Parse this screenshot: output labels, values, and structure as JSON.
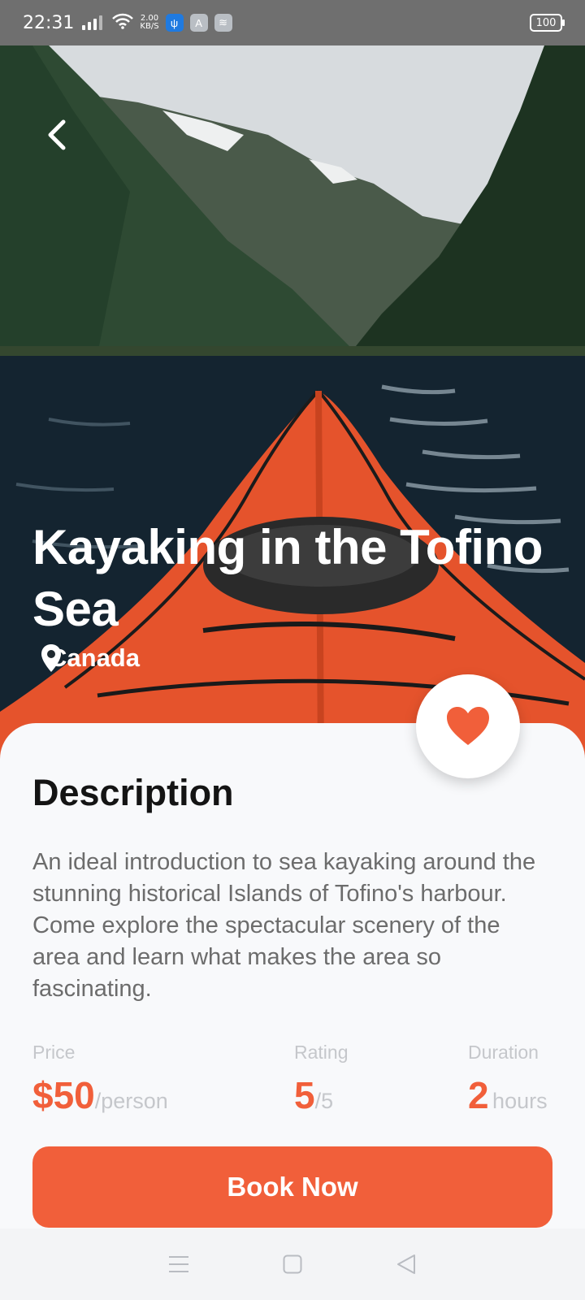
{
  "status_bar": {
    "time": "22:31",
    "net_speed_value": "2.00",
    "net_speed_unit": "KB/S",
    "battery": "100"
  },
  "hero": {
    "title": "Kayaking in the Tofino Sea",
    "location": "Canada"
  },
  "description": {
    "heading": "Description",
    "text": "An ideal introduction to sea kayaking around the stunning historical Islands of Tofino's harbour. Come explore the spectacular scenery of the area and learn what makes the area so fascinating."
  },
  "stats": {
    "price": {
      "label": "Price",
      "value": "$50",
      "unit": "/person"
    },
    "rating": {
      "label": "Rating",
      "value": "5",
      "unit": "/5"
    },
    "duration": {
      "label": "Duration",
      "value": "2",
      "unit": "hours"
    }
  },
  "book_button": {
    "label": "Book Now"
  },
  "colors": {
    "accent": "#f15f3a",
    "background": "#f8f9fb"
  },
  "icons": {
    "back": "chevron-left-icon",
    "location": "map-pin-icon",
    "favorite": "heart-icon",
    "nav_menu": "menu-icon",
    "nav_home": "square-icon",
    "nav_back": "triangle-back-icon"
  }
}
